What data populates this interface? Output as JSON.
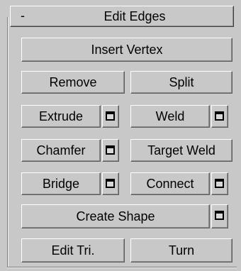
{
  "rollout": {
    "collapse_symbol": "-",
    "title": "Edit Edges"
  },
  "buttons": {
    "insert_vertex": "Insert Vertex",
    "remove": "Remove",
    "split": "Split",
    "extrude": "Extrude",
    "weld": "Weld",
    "chamfer": "Chamfer",
    "target_weld": "Target Weld",
    "bridge": "Bridge",
    "connect": "Connect",
    "create_shape": "Create Shape",
    "edit_tri": "Edit Tri.",
    "turn": "Turn"
  },
  "icons": {
    "settings": "window-settings-icon"
  },
  "colors": {
    "panel_bg": "#c8c8c8",
    "text": "#000000"
  }
}
